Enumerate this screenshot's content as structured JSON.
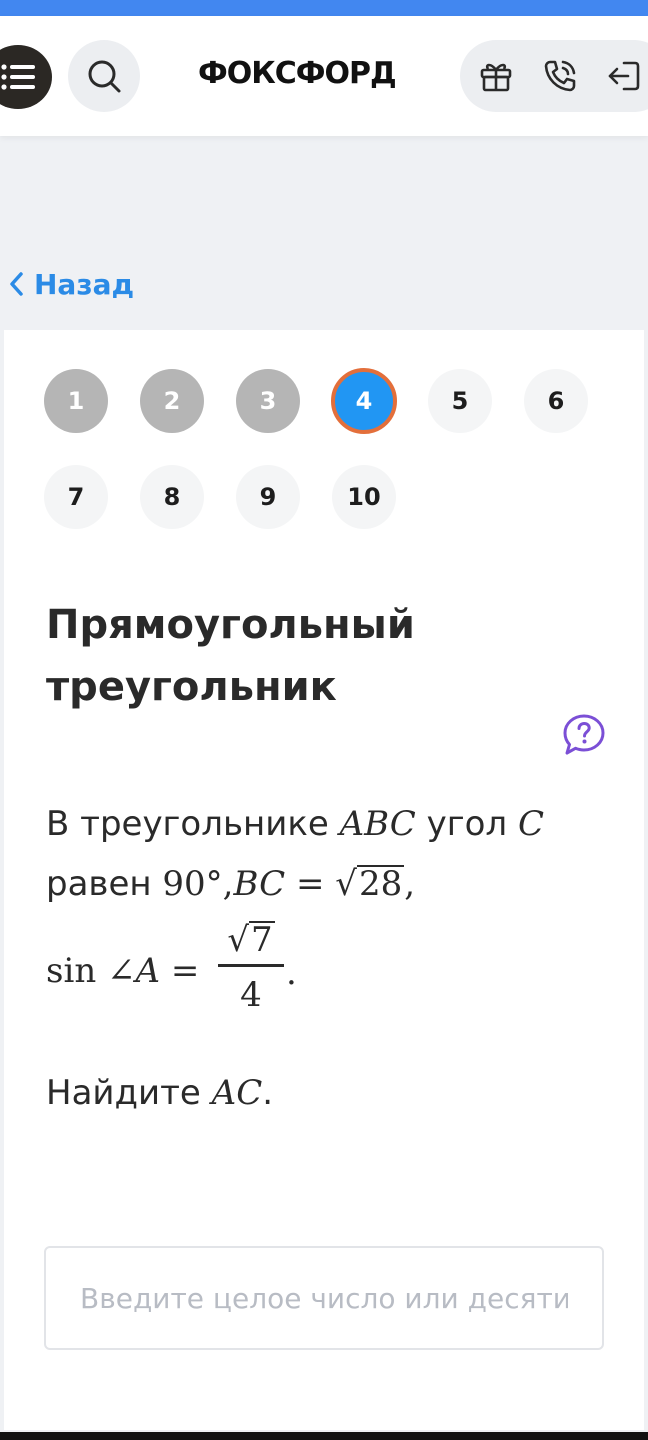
{
  "header": {
    "brand": "ФОКСФОРД"
  },
  "nav": {
    "back_label": "Назад"
  },
  "steps": {
    "items": [
      "1",
      "2",
      "3",
      "4",
      "5",
      "6",
      "7",
      "8",
      "9",
      "10"
    ],
    "current": "4"
  },
  "task": {
    "title": "Прямоугольный треугольник",
    "line1_prefix": "В треугольнике",
    "line1_abc": "ABC",
    "line1_mid": "угол",
    "line1_c": "C",
    "line2_prefix": "равен",
    "line2_angle": "90°,",
    "line2_bc": "BC",
    "line2_eq": "=",
    "line2_sqrt": "28",
    "line2_suffix": ",",
    "line3_sin": "sin",
    "line3_angle": "∠",
    "line3_a": "A",
    "line3_eq": "=",
    "frac_num": "7",
    "frac_den": "4",
    "frac_suffix": ".",
    "question_prefix": "Найдите",
    "question_var": "AC",
    "question_suffix": "."
  },
  "answer": {
    "placeholder": "Введите целое число или десятичную дробь",
    "value": ""
  },
  "colors": {
    "accent": "#2196f3",
    "active_ring": "#e36f3b",
    "link": "#2b8be6",
    "help": "#7b4fd6",
    "topbar": "#4287f0"
  },
  "icons": [
    "menu-icon",
    "search-icon",
    "gift-icon",
    "phone-icon",
    "login-icon",
    "chevron-left-icon",
    "help-icon"
  ]
}
